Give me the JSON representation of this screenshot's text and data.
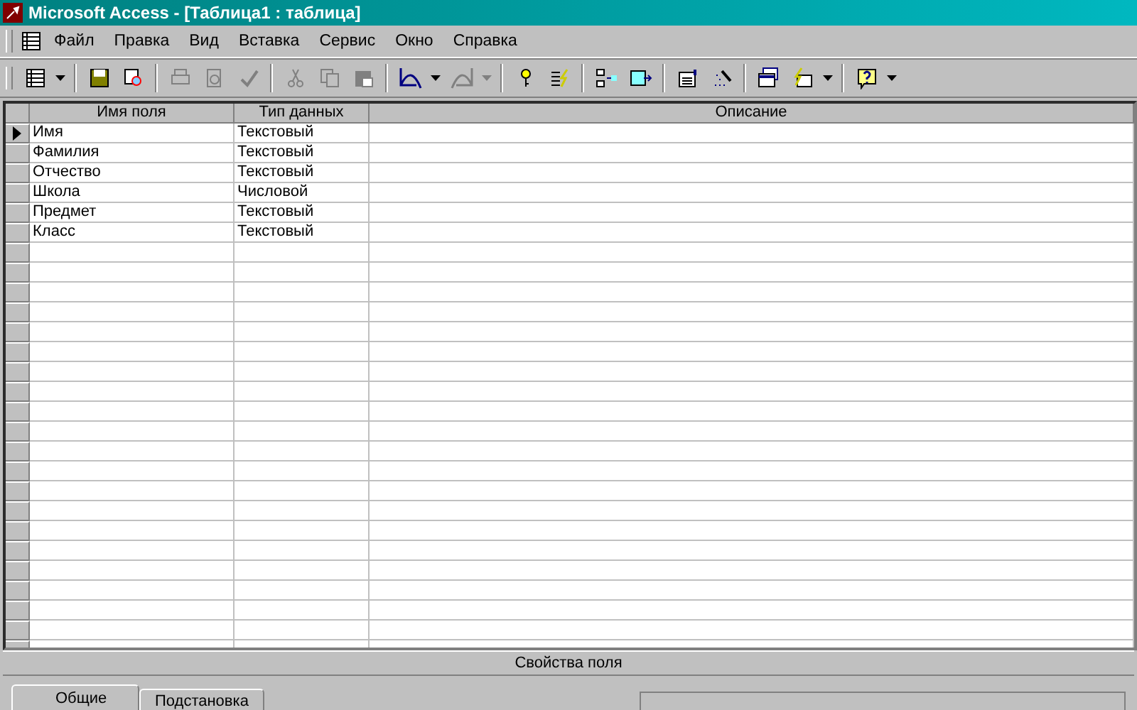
{
  "window": {
    "title": "Microsoft Access - [Таблица1 : таблица]"
  },
  "menu": [
    "Файл",
    "Правка",
    "Вид",
    "Вставка",
    "Сервис",
    "Окно",
    "Справка"
  ],
  "toolbar": [
    {
      "kind": "view",
      "disabled": false
    },
    {
      "kind": "dropdown",
      "disabled": false
    },
    {
      "kind": "sep"
    },
    {
      "kind": "save",
      "disabled": false
    },
    {
      "kind": "search",
      "disabled": false
    },
    {
      "kind": "sep"
    },
    {
      "kind": "print",
      "disabled": true
    },
    {
      "kind": "preview",
      "disabled": true
    },
    {
      "kind": "spell",
      "disabled": true
    },
    {
      "kind": "sep"
    },
    {
      "kind": "cut",
      "disabled": true
    },
    {
      "kind": "copy",
      "disabled": true
    },
    {
      "kind": "paste",
      "disabled": true
    },
    {
      "kind": "sep"
    },
    {
      "kind": "undo",
      "disabled": false
    },
    {
      "kind": "dropdown",
      "disabled": false
    },
    {
      "kind": "redo",
      "disabled": true
    },
    {
      "kind": "dropdown",
      "disabled": true
    },
    {
      "kind": "sep"
    },
    {
      "kind": "key",
      "disabled": false
    },
    {
      "kind": "indexes",
      "disabled": false
    },
    {
      "kind": "sep"
    },
    {
      "kind": "insertrow",
      "disabled": false
    },
    {
      "kind": "deleterow",
      "disabled": false
    },
    {
      "kind": "sep"
    },
    {
      "kind": "properties",
      "disabled": false
    },
    {
      "kind": "builder",
      "disabled": false
    },
    {
      "kind": "sep"
    },
    {
      "kind": "database",
      "disabled": false
    },
    {
      "kind": "newobject",
      "disabled": false
    },
    {
      "kind": "dropdown",
      "disabled": false
    },
    {
      "kind": "sep"
    },
    {
      "kind": "help",
      "disabled": false
    },
    {
      "kind": "dropdown",
      "disabled": false
    }
  ],
  "table": {
    "columns": [
      "Имя поля",
      "Тип данных",
      "Описание"
    ],
    "rows": [
      {
        "name": "Имя",
        "type": "Текстовый",
        "selected": true
      },
      {
        "name": "Фамилия",
        "type": "Текстовый",
        "selected": false
      },
      {
        "name": "Отчество",
        "type": "Текстовый",
        "selected": false
      },
      {
        "name": "Школа",
        "type": "Числовой",
        "selected": false
      },
      {
        "name": "Предмет",
        "type": "Текстовый",
        "selected": false
      },
      {
        "name": "Класс",
        "type": "Текстовый",
        "selected": false
      }
    ]
  },
  "properties": {
    "title": "Свойства поля",
    "tabs": [
      {
        "label": "Общие",
        "selected": true
      },
      {
        "label": "Подстановка",
        "selected": false
      }
    ]
  }
}
